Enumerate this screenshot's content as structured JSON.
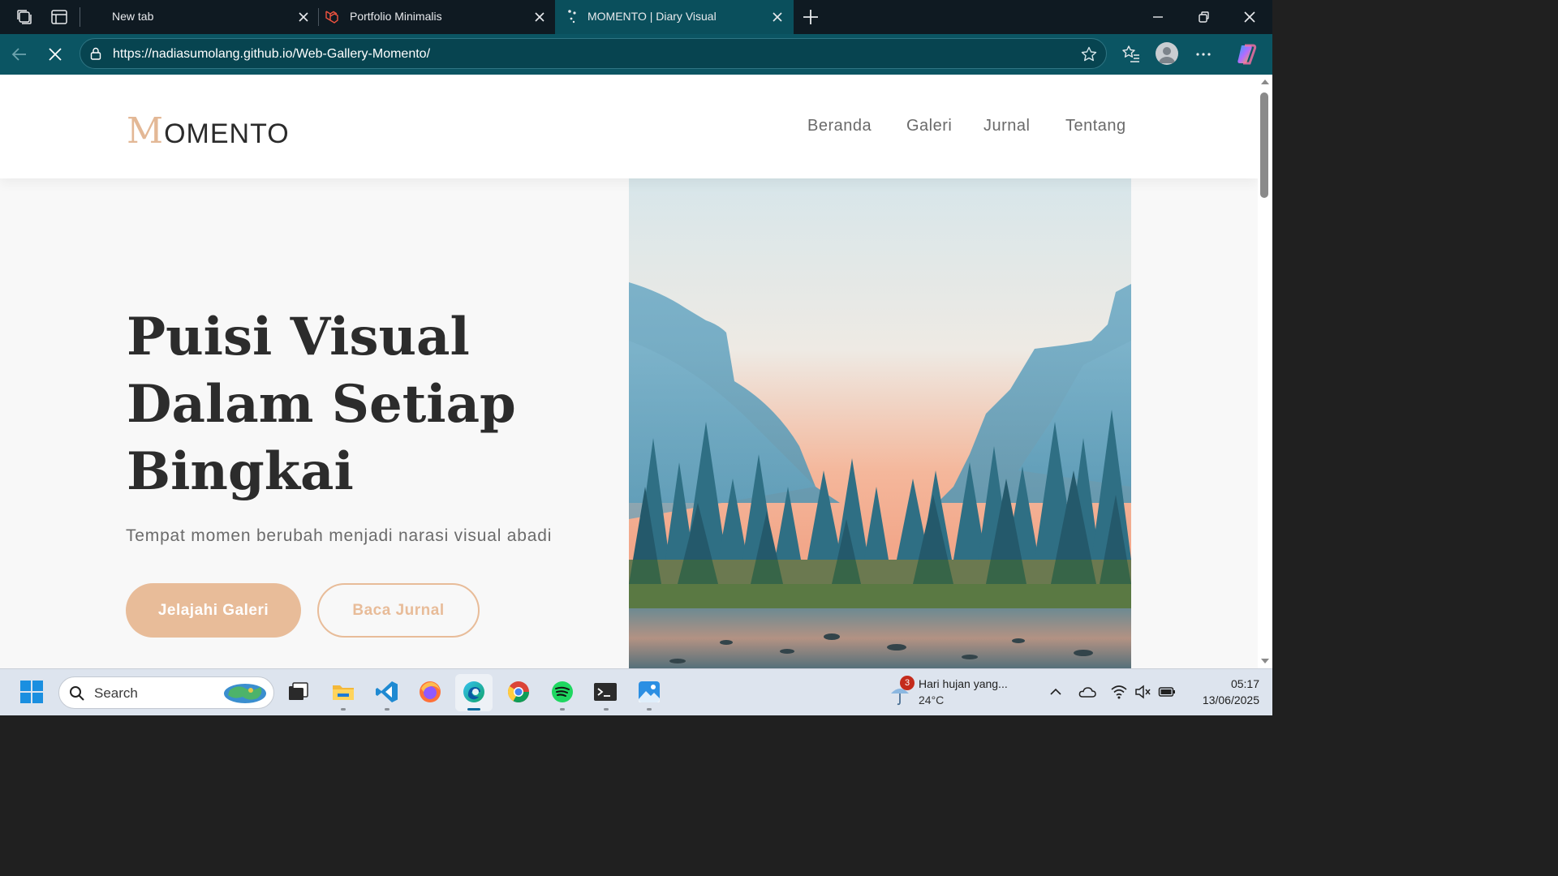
{
  "browser": {
    "tabs": [
      {
        "title": "New tab",
        "active": false
      },
      {
        "title": "Portfolio Minimalis",
        "active": false
      },
      {
        "title": "MOMENTO | Diary Visual",
        "active": true
      }
    ],
    "url": "https://nadiasumolang.github.io/Web-Gallery-Momento/",
    "icons": [
      "workspaces-icon",
      "tab-actions-icon",
      "new-tab-icon",
      "back-icon",
      "stop-loading-icon",
      "lock-icon",
      "favorite-star-icon",
      "favorites-icon",
      "profile-avatar",
      "more-icon",
      "copilot-icon",
      "minimize-icon",
      "restore-icon",
      "close-window-icon"
    ]
  },
  "site": {
    "logo_initial": "M",
    "logo_rest": "OMENTO",
    "nav": [
      "Beranda",
      "Galeri",
      "Jurnal",
      "Tentang"
    ],
    "hero": {
      "title_lines": [
        "Puisi Visual",
        "Dalam Setiap",
        "Bingkai"
      ],
      "subtitle": "Tempat momen berubah menjadi narasi visual abadi",
      "primary_button": "Jelajahi Galeri",
      "secondary_button": "Baca Jurnal"
    },
    "colors": {
      "accent": "#e8bc99",
      "heading": "#2c2c2c",
      "background": "#f8f8f8"
    }
  },
  "taskbar": {
    "search_placeholder": "Search",
    "apps": [
      "start-icon",
      "task-view-icon",
      "file-explorer-icon",
      "vscode-icon",
      "firefox-icon",
      "edge-icon",
      "chrome-icon",
      "spotify-icon",
      "terminal-icon",
      "photos-icon"
    ],
    "weather": {
      "badge": "3",
      "text": "Hari hujan yang...",
      "temp": "24°C"
    },
    "tray": [
      "show-hidden-icons-chevron",
      "onedrive-icon",
      "wifi-icon",
      "volume-muted-icon",
      "battery-icon"
    ],
    "time": "05:17",
    "date": "13/06/2025"
  }
}
